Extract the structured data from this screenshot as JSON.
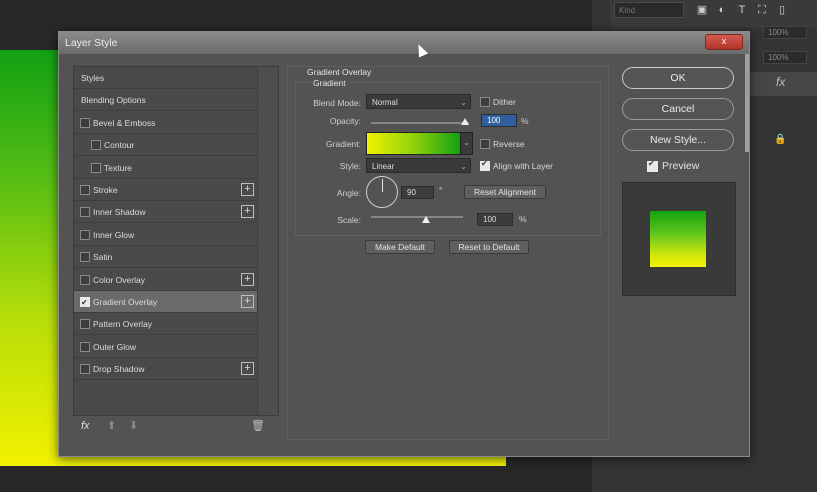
{
  "dialog": {
    "title": "Layer Style",
    "close_label": "x"
  },
  "styles_list": {
    "items": [
      {
        "label": "Styles",
        "checkbox": false,
        "checked": false,
        "plus": false,
        "indent": 0
      },
      {
        "label": "Blending Options",
        "checkbox": false,
        "checked": false,
        "plus": false,
        "indent": 0
      },
      {
        "label": "Bevel & Emboss",
        "checkbox": true,
        "checked": false,
        "plus": false,
        "indent": 0
      },
      {
        "label": "Contour",
        "checkbox": true,
        "checked": false,
        "plus": false,
        "indent": 1
      },
      {
        "label": "Texture",
        "checkbox": true,
        "checked": false,
        "plus": false,
        "indent": 1
      },
      {
        "label": "Stroke",
        "checkbox": true,
        "checked": false,
        "plus": true,
        "indent": 0
      },
      {
        "label": "Inner Shadow",
        "checkbox": true,
        "checked": false,
        "plus": true,
        "indent": 0
      },
      {
        "label": "Inner Glow",
        "checkbox": true,
        "checked": false,
        "plus": false,
        "indent": 0
      },
      {
        "label": "Satin",
        "checkbox": true,
        "checked": false,
        "plus": false,
        "indent": 0
      },
      {
        "label": "Color Overlay",
        "checkbox": true,
        "checked": false,
        "plus": true,
        "indent": 0
      },
      {
        "label": "Gradient Overlay",
        "checkbox": true,
        "checked": true,
        "plus": true,
        "indent": 0,
        "selected": true
      },
      {
        "label": "Pattern Overlay",
        "checkbox": true,
        "checked": false,
        "plus": false,
        "indent": 0
      },
      {
        "label": "Outer Glow",
        "checkbox": true,
        "checked": false,
        "plus": false,
        "indent": 0
      },
      {
        "label": "Drop Shadow",
        "checkbox": true,
        "checked": false,
        "plus": true,
        "indent": 0
      }
    ],
    "footer_icons": [
      "fx-icon",
      "arrow-up-icon",
      "arrow-down-icon",
      "trash-icon"
    ],
    "fx_label": "fx"
  },
  "gradient_overlay": {
    "section_title": "Gradient Overlay",
    "group_title": "Gradient",
    "blend_mode_label": "Blend Mode:",
    "blend_mode_value": "Normal",
    "dither_label": "Dither",
    "dither_checked": false,
    "opacity_label": "Opacity:",
    "opacity_value": "100",
    "opacity_unit": "%",
    "opacity_fraction": 1.0,
    "gradient_label": "Gradient:",
    "gradient_colors": [
      "#f2f200",
      "#8fd20c",
      "#14a014"
    ],
    "reverse_label": "Reverse",
    "reverse_checked": false,
    "style_label": "Style:",
    "style_value": "Linear",
    "align_label": "Align with Layer",
    "align_checked": true,
    "angle_label": "Angle:",
    "angle_value": "90",
    "angle_unit": "°",
    "reset_alignment_label": "Reset Alignment",
    "scale_label": "Scale:",
    "scale_value": "100",
    "scale_unit": "%",
    "scale_fraction": 0.6,
    "make_default_label": "Make Default",
    "reset_default_label": "Reset to Default"
  },
  "buttons": {
    "ok": "OK",
    "cancel": "Cancel",
    "new_style": "New Style...",
    "preview_label": "Preview",
    "preview_checked": true
  },
  "workspace": {
    "search_placeholder": "Kind",
    "opacity_pct": "100%",
    "fill_pct": "100%",
    "fx_label": "fx",
    "canvas_colors": [
      "#12a012",
      "#f2f200"
    ]
  }
}
